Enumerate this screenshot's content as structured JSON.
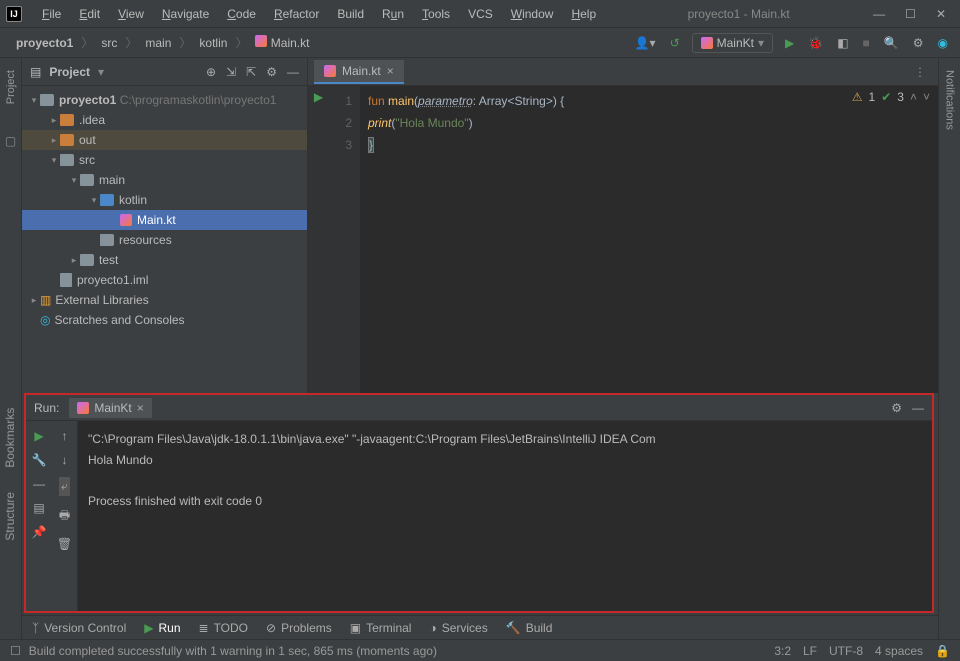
{
  "window": {
    "title": "proyecto1 - Main.kt"
  },
  "menu": {
    "file": "File",
    "edit": "Edit",
    "view": "View",
    "navigate": "Navigate",
    "code": "Code",
    "refactor": "Refactor",
    "build": "Build",
    "run": "Run",
    "tools": "Tools",
    "vcs": "VCS",
    "window": "Window",
    "help": "Help"
  },
  "breadcrumb": {
    "project": "proyecto1",
    "src": "src",
    "main": "main",
    "kotlin": "kotlin",
    "file": "Main.kt"
  },
  "runconfig": {
    "name": "MainKt"
  },
  "project_panel": {
    "title": "Project",
    "root": "proyecto1",
    "root_path": "C:\\programaskotlin\\proyecto1",
    "idea": ".idea",
    "out": "out",
    "src": "src",
    "main": "main",
    "kotlin": "kotlin",
    "mainfile": "Main.kt",
    "resources": "resources",
    "test": "test",
    "iml": "proyecto1.iml",
    "external": "External Libraries",
    "scratches": "Scratches and Consoles"
  },
  "editor": {
    "tab": "Main.kt",
    "line1": "1",
    "line2": "2",
    "line3": "3",
    "kw_fun": "fun",
    "fn_main": "main",
    "param": "parametro",
    "arr": "Array",
    "str": "String",
    "print": "print",
    "literal": "\"Hola Mundo\"",
    "ind_warn": "1",
    "ind_ok": "3"
  },
  "run": {
    "label": "Run:",
    "config": "MainKt",
    "l1": "\"C:\\Program Files\\Java\\jdk-18.0.1.1\\bin\\java.exe\" \"-javaagent:C:\\Program Files\\JetBrains\\IntelliJ IDEA Com",
    "l2": "Hola Mundo",
    "l3": "Process finished with exit code 0"
  },
  "bottom": {
    "vcs": "Version Control",
    "run": "Run",
    "todo": "TODO",
    "problems": "Problems",
    "terminal": "Terminal",
    "services": "Services",
    "build": "Build"
  },
  "status": {
    "msg": "Build completed successfully with 1 warning in 1 sec, 865 ms (moments ago)",
    "pos": "3:2",
    "lf": "LF",
    "enc": "UTF-8",
    "indent": "4 spaces"
  },
  "gutters": {
    "project": "Project",
    "structure": "Structure",
    "bookmarks": "Bookmarks",
    "notifications": "Notifications"
  }
}
